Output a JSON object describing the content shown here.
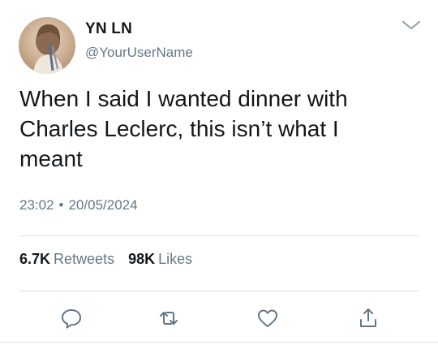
{
  "user": {
    "display_name": "YN LN",
    "username": "@YourUserName",
    "avatar": "profile-photo"
  },
  "tweet": {
    "text": "When I said I wanted dinner with\nCharles Leclerc, this isn’t what I\nmeant",
    "time": "23:02",
    "separator": "•",
    "date": "20/05/2024"
  },
  "stats": {
    "retweets_count": "6.7K",
    "retweets_label": "Retweets",
    "likes_count": "98K",
    "likes_label": "Likes"
  },
  "icons": {
    "menu": "chevron-down-icon",
    "reply": "reply-icon",
    "retweet": "retweet-icon",
    "like": "heart-icon",
    "share": "share-icon"
  },
  "colors": {
    "text": "#14171a",
    "secondary": "#657786",
    "divider": "#d9dfe3",
    "icon": "#657786"
  }
}
